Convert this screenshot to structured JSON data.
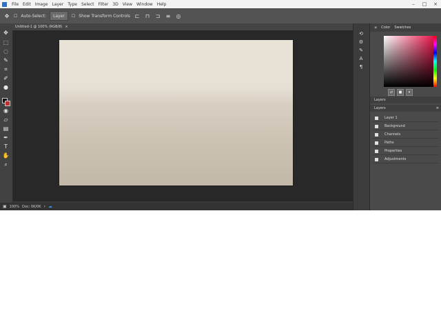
{
  "app": {
    "menu": [
      "File",
      "Edit",
      "Image",
      "Layer",
      "Type",
      "Select",
      "Filter",
      "3D",
      "View",
      "Window",
      "Help"
    ],
    "window_controls": [
      "–",
      "□",
      "×"
    ]
  },
  "options_bar": {
    "move_icon": "move-tool-icon",
    "auto_select_label": "Auto-Select:",
    "layer_select": "Layer",
    "transform_label": "Show Transform Controls"
  },
  "document": {
    "tab_label": "Untitled-1 @ 100% (RGB/8)"
  },
  "status": {
    "zoom": "100%",
    "doc_size": "Doc: 0K/0K"
  },
  "panels": {
    "color_tab": "Color",
    "swatches_tab": "Swatches",
    "layers_section": "Layers",
    "layers_tab": "Layers",
    "layer_items": [
      "Layer 1",
      "Background",
      "Channels",
      "Paths",
      "Properties",
      "Adjustments"
    ]
  },
  "colors": {
    "foreground": "#111111",
    "background": "#c03030",
    "accent": "#2a70c8"
  }
}
